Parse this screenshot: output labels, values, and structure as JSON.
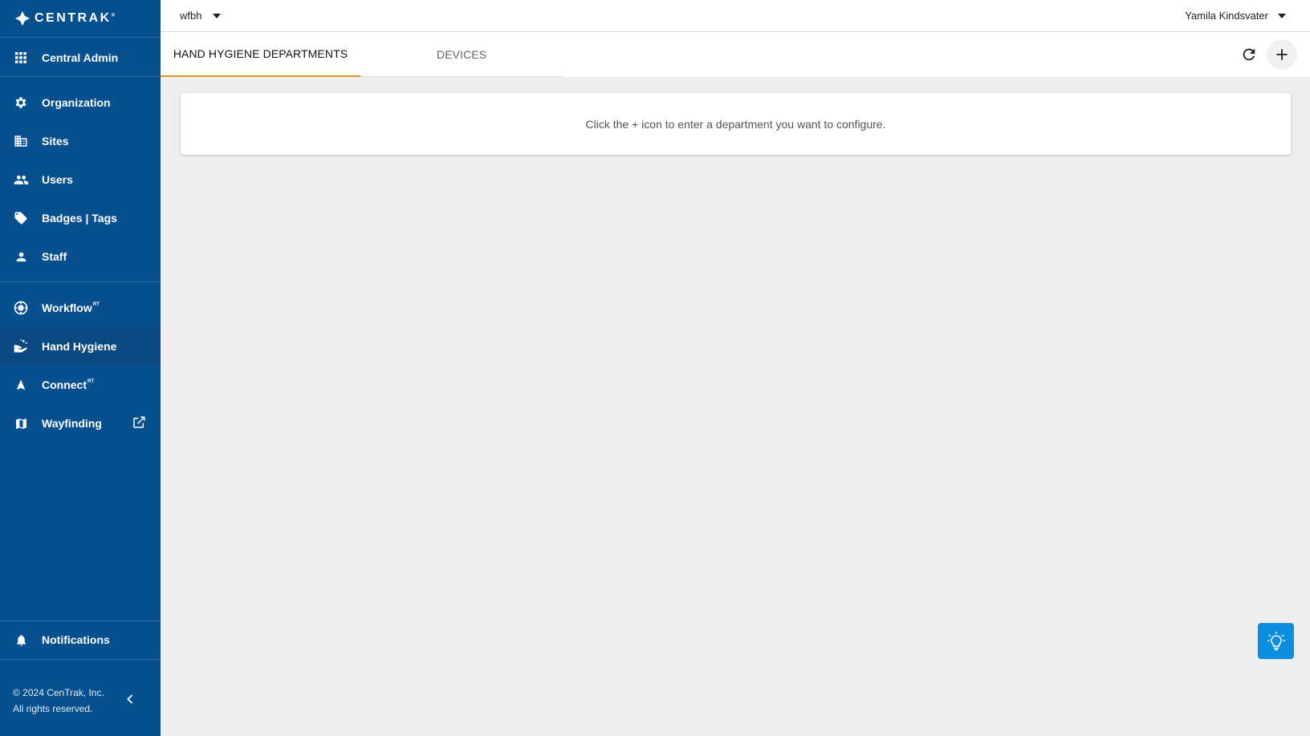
{
  "brand": {
    "name": "CENTRAK",
    "mark": "®"
  },
  "sidebar": {
    "items": [
      {
        "label": "Central Admin",
        "icon": "grid-icon"
      },
      {
        "label": "Organization",
        "icon": "gear-icon"
      },
      {
        "label": "Sites",
        "icon": "building-icon"
      },
      {
        "label": "Users",
        "icon": "people-icon"
      },
      {
        "label": "Badges | Tags",
        "icon": "tag-icon"
      },
      {
        "label": "Staff",
        "icon": "person-icon"
      },
      {
        "label": "Workflow",
        "sup": "RT",
        "icon": "workflow-icon"
      },
      {
        "label": "Hand Hygiene",
        "icon": "hand-wash-icon",
        "active": true
      },
      {
        "label": "Connect",
        "sup": "RT",
        "icon": "navigation-arrow-icon"
      },
      {
        "label": "Wayfinding",
        "icon": "map-icon",
        "external": true
      },
      {
        "label": "Notifications",
        "icon": "bell-icon"
      }
    ],
    "copyright_line1": "© 2024 CenTrak, Inc.",
    "copyright_line2": "All rights reserved."
  },
  "topbar": {
    "site": "wfbh",
    "user": "Yamila Kindsvater"
  },
  "tabs": [
    {
      "label": "HAND HYGIENE DEPARTMENTS",
      "active": true
    },
    {
      "label": "DEVICES",
      "active": false
    }
  ],
  "content": {
    "empty_message": "Click the + icon to enter a department you want to configure."
  },
  "colors": {
    "sidebar": "#06508f",
    "active_tab_underline": "#e8951f",
    "help_button": "#0a8ee0"
  }
}
